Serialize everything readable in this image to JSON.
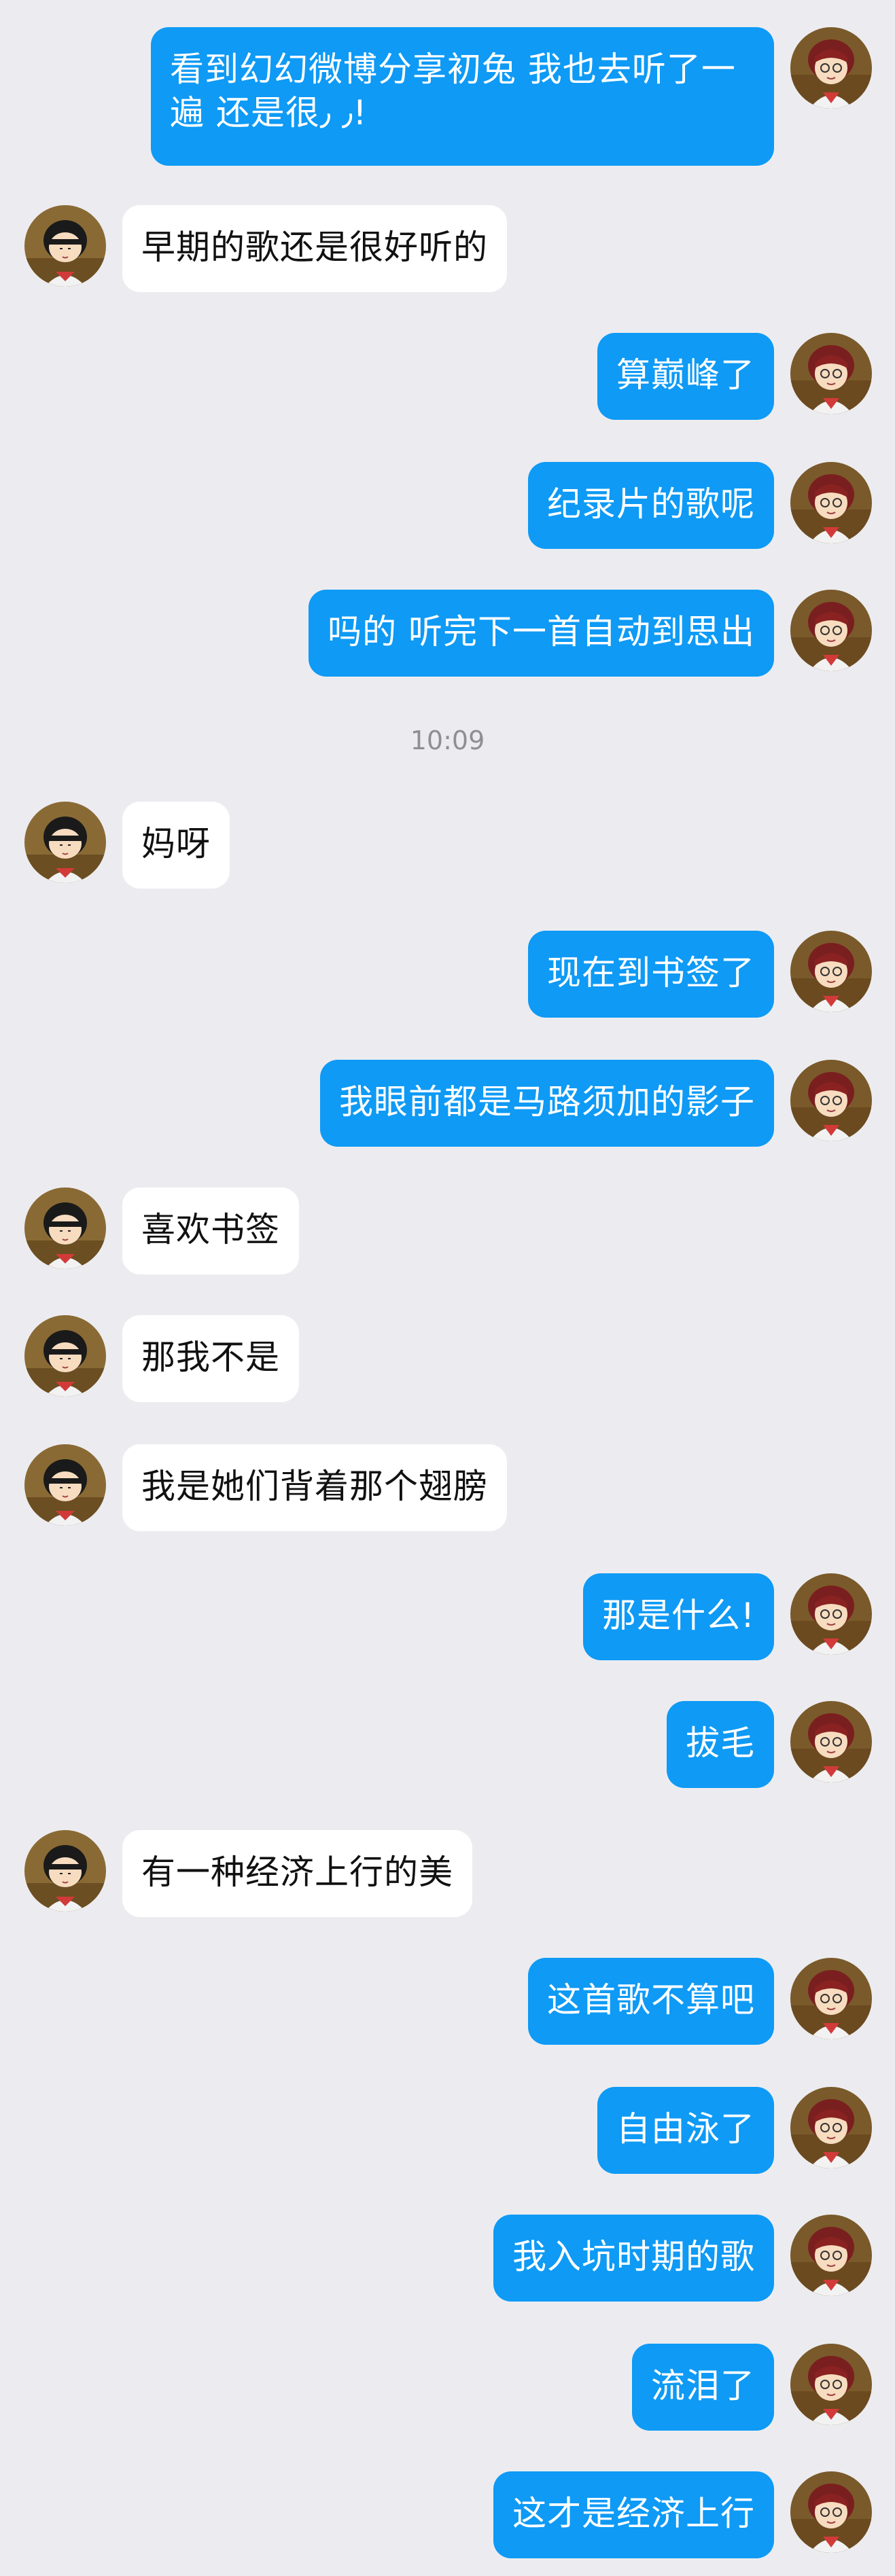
{
  "colors": {
    "background": "#ececf0",
    "outgoing_bubble": "#0e9af5",
    "incoming_bubble": "#ffffff",
    "timestamp_text": "#8e8e93"
  },
  "messages": [
    {
      "side": "out",
      "text": "看到幻幻微博分享初兔 我也去听了一遍 还是很٫ ٫!"
    },
    {
      "side": "in",
      "text": "早期的歌还是很好听的"
    },
    {
      "side": "out",
      "text": "算巅峰了"
    },
    {
      "side": "out",
      "text": "纪录片的歌呢"
    },
    {
      "side": "out",
      "text": "吗的 听完下一首自动到思出"
    },
    {
      "side": "timestamp",
      "text": "10:09"
    },
    {
      "side": "in",
      "text": "妈呀"
    },
    {
      "side": "out",
      "text": "现在到书签了"
    },
    {
      "side": "out",
      "text": "我眼前都是马路须加的影子"
    },
    {
      "side": "in",
      "text": "喜欢书签"
    },
    {
      "side": "in",
      "text": "那我不是"
    },
    {
      "side": "in",
      "text": "我是她们背着那个翅膀"
    },
    {
      "side": "out",
      "text": "那是什么!"
    },
    {
      "side": "out",
      "text": "拔毛"
    },
    {
      "side": "in",
      "text": "有一种经济上行的美"
    },
    {
      "side": "out",
      "text": "这首歌不算吧"
    },
    {
      "side": "out",
      "text": "自由泳了"
    },
    {
      "side": "out",
      "text": "我入坑时期的歌"
    },
    {
      "side": "out",
      "text": "流泪了"
    },
    {
      "side": "out",
      "text": "这才是经济上行"
    }
  ]
}
